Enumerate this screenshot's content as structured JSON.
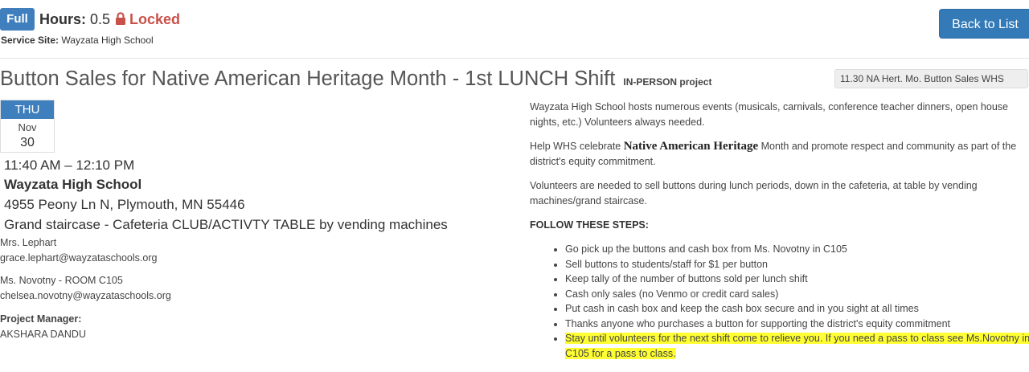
{
  "header": {
    "badge": "Full",
    "hours_label": "Hours:",
    "hours_value": "0.5",
    "locked_label": "Locked",
    "service_site_label": "Service Site:",
    "service_site_value": "Wayzata High School",
    "back_button": "Back to List"
  },
  "project": {
    "title": "Button Sales for Native American Heritage Month - 1st LUNCH Shift",
    "type_label": "IN-PERSON project",
    "code": "11.30 NA Hert. Mo. Button Sales WHS"
  },
  "calendar": {
    "day": "THU",
    "month": "Nov",
    "date": "30"
  },
  "details": {
    "time": "11:40 AM – 12:10 PM",
    "site_name": "Wayzata High School",
    "address": "4955 Peony Ln N, Plymouth, MN 55446",
    "location": "Grand staircase - Cafeteria CLUB/ACTIVTY TABLE by vending machines"
  },
  "contacts": [
    {
      "name": "Mrs. Lephart",
      "email": "grace.lephart@wayzataschools.org"
    },
    {
      "name": "Ms. Novotny - ROOM C105",
      "email": "chelsea.novotny@wayzataschools.org"
    }
  ],
  "project_manager": {
    "label": "Project Manager:",
    "name": "AKSHARA DANDU"
  },
  "description": {
    "p1": "Wayzata High School hosts numerous events (musicals, carnivals, conference teacher dinners, open house nights, etc.)  Volunteers always needed.",
    "p2_before": "Help WHS celebrate ",
    "p2_bold": "Native American Heritage",
    "p2_after": " Month and promote respect and community as part of the district's equity commitment.",
    "p3": "Volunteers are needed to sell buttons during lunch periods, down in the cafeteria, at table by vending machines/grand staircase.",
    "steps_heading": "FOLLOW THESE STEPS:",
    "steps": [
      "Go pick up the buttons and cash box from Ms. Novotny in C105",
      "Sell buttons to students/staff for $1 per button",
      "Keep tally of the number of buttons sold per lunch shift",
      "Cash only sales (no Venmo or credit card sales)",
      "Put cash in cash box and keep the cash box secure and in you sight at all times",
      "Thanks anyone who purchases a button for supporting the district's equity commitment",
      "Stay until volunteers for the next shift come to relieve you. If you need a pass to class see Ms.Novotny in C105 for a pass to class."
    ]
  },
  "colors": {
    "primary": "#337ab7",
    "badge": "#3f7fbd",
    "locked": "#c9514a",
    "highlight": "#ffff33"
  },
  "icons": {
    "lock": "lock-icon"
  }
}
